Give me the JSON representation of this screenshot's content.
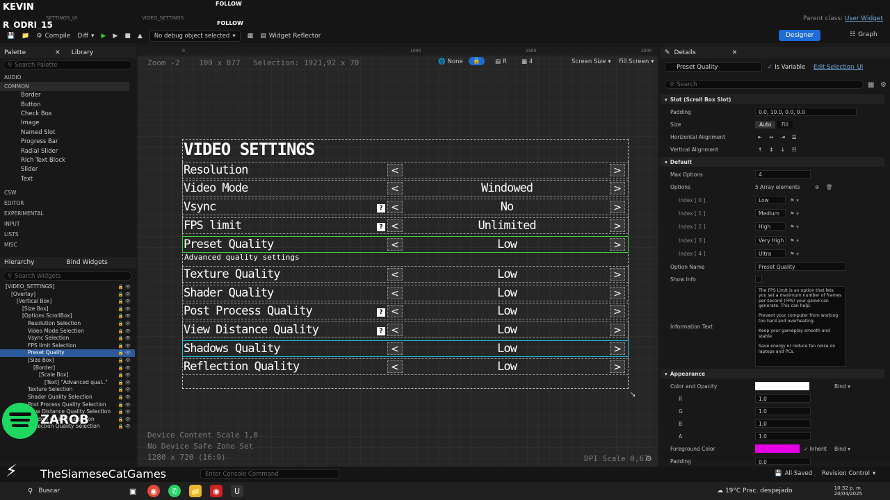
{
  "window": {
    "title_top": "KEVIN",
    "title_bp": "R_ODRI_15",
    "follow1": "FOLLOW",
    "follow2": "FOLLOW",
    "tab1": "SETTINGS_UI",
    "tab2": "VIDEO_SETTINGS",
    "parent_class_label": "Parent class:",
    "parent_class_value": "User Widget"
  },
  "toolbar": {
    "compile": "Compile",
    "diff": "Diff",
    "debug_select": "No debug object selected",
    "widget_reflector": "Widget Reflector",
    "designer": "Designer",
    "graph": "Graph"
  },
  "palette": {
    "tab_palette": "Palette",
    "tab_library": "Library",
    "search_placeholder": "Search Palette",
    "cat_audio": "AUDIO",
    "cat_common": "COMMON",
    "items": [
      "Border",
      "Button",
      "Check Box",
      "Image",
      "Named Slot",
      "Progress Bar",
      "Radial Slider",
      "Rich Text Block",
      "Slider",
      "Text"
    ],
    "cats_after": [
      "CSW",
      "EDITOR",
      "EXPERIMENTAL",
      "INPUT",
      "LISTS",
      "MISC"
    ]
  },
  "hierarchy": {
    "tab_hierarchy": "Hierarchy",
    "tab_bind": "Bind Widgets",
    "search_placeholder": "Search Widgets",
    "rows": [
      "[VIDEO_SETTINGS]",
      "[Overlay]",
      "[Vertical Box]",
      "[Size Box]",
      "[Options ScrollBox]",
      "Resolution Selection",
      "Video Mode Selection",
      "Vsync Selection",
      "FPS limit Selection",
      "Preset Quality",
      "[Size Box]",
      "[Border]",
      "[Scale Box]",
      "[Text] \"Advanced qual..\"",
      "Texture Selection",
      "Shader Quality Selection",
      "Post Process Quality Selection",
      "View Distance Quality Selection",
      "Shadow Quality Selection",
      "Reflection Quality Selection"
    ]
  },
  "canvas": {
    "zoom": "Zoom -2",
    "size": "100 x 877",
    "selection": "Selection: 1921,92 x 70",
    "none": "None",
    "r_label": "R",
    "four": "4",
    "screen_size": "Screen Size",
    "fill_screen": "Fill Screen",
    "ruler": [
      "0",
      "1000",
      "1500",
      "2000"
    ],
    "device_scale": "Device Content Scale 1,0",
    "safe_zone": "No Device Safe Zone Set",
    "res": "1280 x 720 (16:9)",
    "dpi": "DPI Scale 0,67"
  },
  "video_settings": {
    "title": "VIDEO SETTINGS",
    "advanced": "Advanced quality settings",
    "rows": [
      {
        "label": "Resolution",
        "value": "",
        "q": false
      },
      {
        "label": "Video Mode",
        "value": "Windowed",
        "q": false
      },
      {
        "label": "Vsync",
        "value": "No",
        "q": true
      },
      {
        "label": "FPS limit",
        "value": "Unlimited",
        "q": true
      },
      {
        "label": "Preset Quality",
        "value": "Low",
        "q": false
      },
      {
        "label": "Texture Quality",
        "value": "Low",
        "q": false
      },
      {
        "label": "Shader Quality",
        "value": "Low",
        "q": false
      },
      {
        "label": "Post Process Quality",
        "value": "Low",
        "q": true
      },
      {
        "label": "View Distance Quality",
        "value": "Low",
        "q": true
      },
      {
        "label": "Shadows Quality",
        "value": "Low",
        "q": false
      },
      {
        "label": "Reflection Quality",
        "value": "Low",
        "q": false
      }
    ],
    "arrow_left": "<",
    "arrow_right": ">",
    "q_mark": "?"
  },
  "details": {
    "tab": "Details",
    "widget_name": "Preset Quality",
    "is_variable": "Is Variable",
    "edit_selection": "Edit Selection_UI",
    "search_placeholder": "Search",
    "slot_section": "Slot (Scroll Box Slot)",
    "padding": "Padding",
    "padding_val": "0.0, 10.0, 0.0, 0.0",
    "size": "Size",
    "auto": "Auto",
    "fill": "Fill",
    "halign": "Horizontal Alignment",
    "valign": "Vertical Alignment",
    "default_section": "Default",
    "max_options": "Max Options",
    "max_options_val": "4",
    "options": "Options",
    "options_val": "5 Array elements",
    "indices": [
      {
        "n": "Index [ 0 ]",
        "v": "Low"
      },
      {
        "n": "Index [ 1 ]",
        "v": "Medium"
      },
      {
        "n": "Index [ 2 ]",
        "v": "High"
      },
      {
        "n": "Index [ 3 ]",
        "v": "Very High"
      },
      {
        "n": "Index [ 4 ]",
        "v": "Ultra"
      }
    ],
    "option_name": "Option Name",
    "option_name_val": "Preset Quality",
    "show_info": "Show Info",
    "info_text": "Information Text",
    "info_val": "The FPS Limit is an option that lets you set a maximum number of frames per second (FPS) your game can generate. This can help:\n\nPrevent your computer from working too hard and overheating.\n\nKeep your gameplay smooth and stable.\n\nSave energy or reduce fan noise on laptops and PCs.",
    "appearance": "Appearance",
    "color_opacity": "Color and Opacity",
    "bind": "Bind",
    "r": "R",
    "g": "G",
    "b": "B",
    "a": "A",
    "rv": "1.0",
    "gv": "1.0",
    "bv": "1.0",
    "av": "1.0",
    "fg_color": "Foreground Color",
    "inherit": "Inherit",
    "padding2": "Padding",
    "padding2_val": "0.0",
    "colors": {
      "white": "#ffffff",
      "magenta": "#e600e6"
    }
  },
  "status": {
    "console_placeholder": "Enter Console Command",
    "all_saved": "All Saved",
    "revision": "Revision Control",
    "channel": "TheSiameseCatGames",
    "spotify_user": "ZAROB"
  },
  "taskbar": {
    "search": "Buscar",
    "weather": "19°C  Prac. despejado",
    "time": "10:32 p. m.",
    "date": "20/04/2025"
  }
}
